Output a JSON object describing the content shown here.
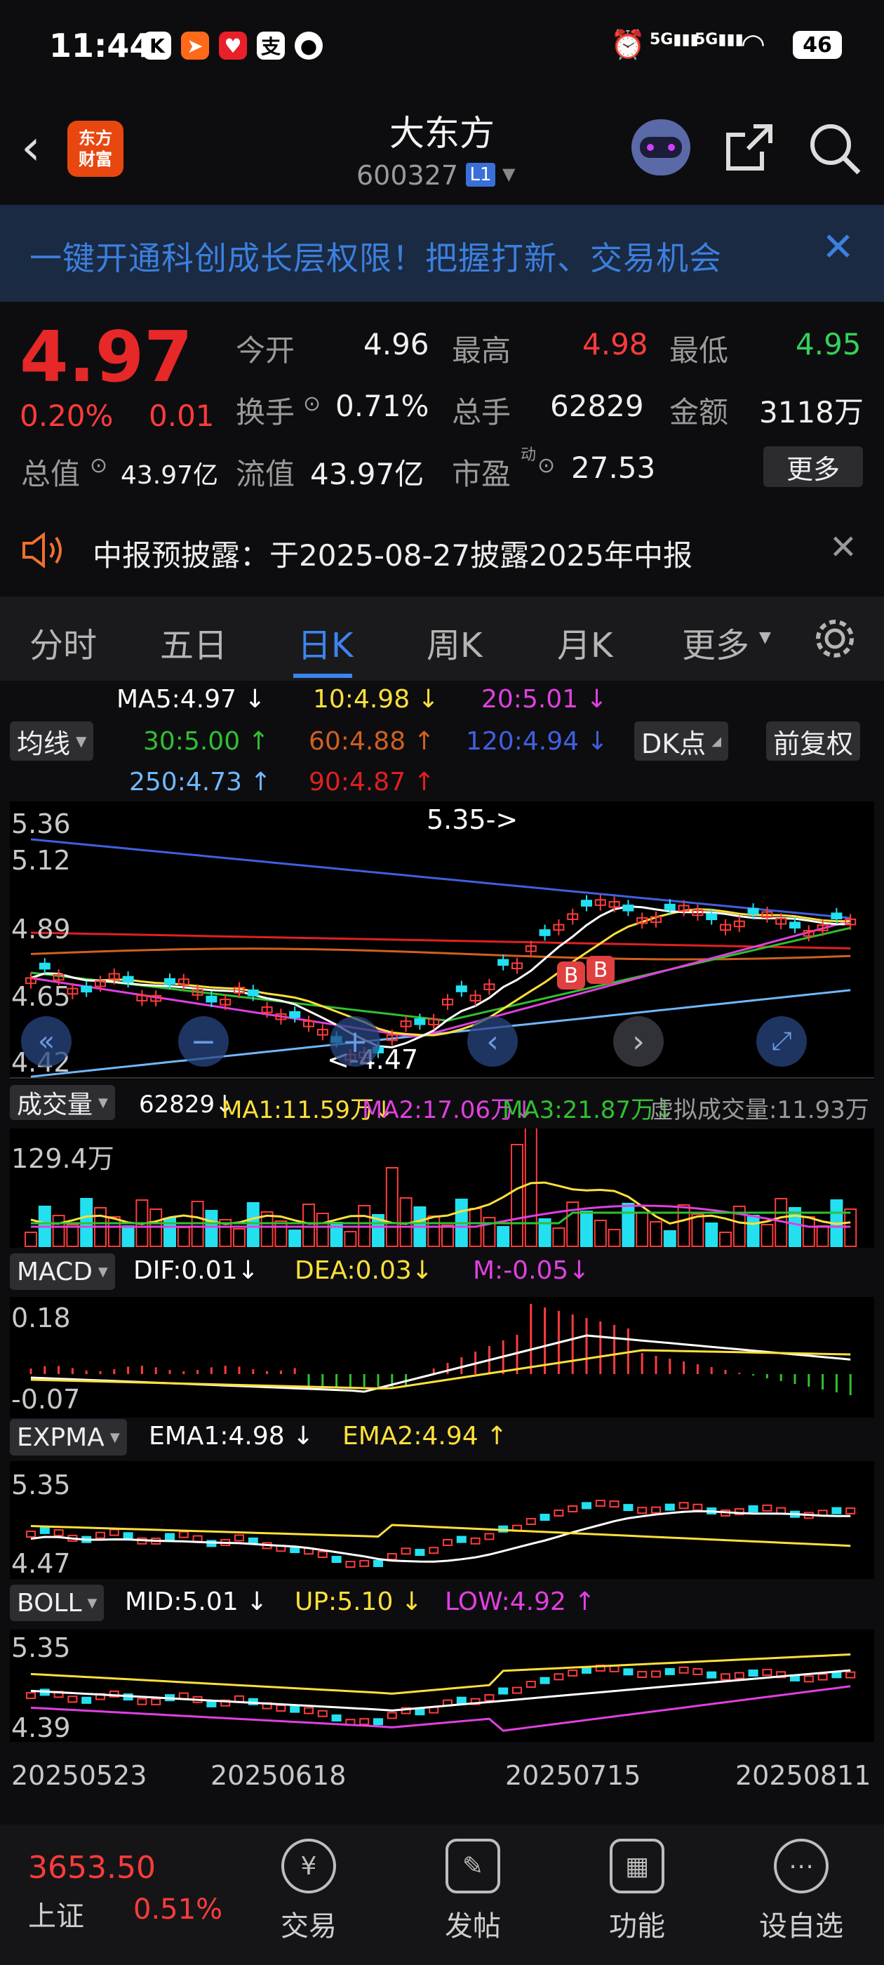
{
  "status": {
    "time": "11:44",
    "battery": "46",
    "icons": [
      "k-app-icon",
      "paper-plane-icon",
      "heart-app-icon",
      "alipay-icon",
      "location-icon"
    ]
  },
  "header": {
    "title": "大东方",
    "code": "600327",
    "badge": "L1",
    "logo_line1": "东方",
    "logo_line2": "财富"
  },
  "banner": {
    "text": "一键开通科创成长层权限！把握打新、交易机会"
  },
  "quote": {
    "price": "4.97",
    "pct": "0.20%",
    "chg": "0.01",
    "open_label": "今开",
    "open": "4.96",
    "high_label": "最高",
    "high": "4.98",
    "low_label": "最低",
    "low": "4.95",
    "turnover_label": "换手",
    "turnover": "0.71%",
    "volume_label": "总手",
    "volume": "62829",
    "amount_label": "金额",
    "amount": "3118万",
    "mcap_label": "总值",
    "mcap": "43.97亿",
    "float_label": "流值",
    "float": "43.97亿",
    "pe_label": "市盈",
    "pe_sup": "动",
    "pe": "27.53",
    "more": "更多"
  },
  "notice": {
    "text": "中报预披露：于2025-08-27披露2025年中报"
  },
  "tabs": {
    "items": [
      "分时",
      "五日",
      "日K",
      "周K",
      "月K",
      "更多"
    ],
    "active": 2
  },
  "ma": {
    "selector": "均线",
    "dk": "DK点",
    "adj": "前复权",
    "ma5": "MA5:4.97",
    "ma10": "10:4.98",
    "ma20": "20:5.01",
    "ma30": "30:5.00",
    "ma60": "60:4.88",
    "ma120": "120:4.94",
    "ma250": "250:4.73",
    "ma90": "90:4.87",
    "ma5_arrow": "↓",
    "ma10_arrow": "↓",
    "ma20_arrow": "↓",
    "ma30_arrow": "↑",
    "ma60_arrow": "↑",
    "ma120_arrow": "↓",
    "ma250_arrow": "↑",
    "ma90_arrow": "↑"
  },
  "kline": {
    "y1": "5.36",
    "y2": "5.12",
    "y3": "4.89",
    "y4": "4.65",
    "y5": "4.42",
    "peak_label": "5.35->",
    "trough_label": "<-4.47",
    "marker": "B"
  },
  "volume": {
    "selector": "成交量",
    "vol": "62829",
    "vol_arrow": "↓",
    "ma1": "MA1:11.59万",
    "ma1_arrow": "↓",
    "ma2": "MA2:17.06万",
    "ma2_arrow": "↓",
    "ma3": "MA3:21.87万",
    "ma3_arrow": "↓",
    "virtual": "虚拟成交量:11.93万",
    "ymax": "129.4万"
  },
  "macd": {
    "selector": "MACD",
    "dif": "DIF:0.01",
    "dif_arrow": "↓",
    "dea": "DEA:0.03",
    "dea_arrow": "↓",
    "m": "M:-0.05",
    "m_arrow": "↓",
    "ymax": "0.18",
    "ymin": "-0.07"
  },
  "expma": {
    "selector": "EXPMA",
    "ema1": "EMA1:4.98",
    "ema1_arrow": "↓",
    "ema2": "EMA2:4.94",
    "ema2_arrow": "↑",
    "ymax": "5.35",
    "ymin": "4.47"
  },
  "boll": {
    "selector": "BOLL",
    "mid": "MID:5.01",
    "mid_arrow": "↓",
    "up": "UP:5.10",
    "up_arrow": "↓",
    "low": "LOW:4.92",
    "low_arrow": "↑",
    "ymax": "5.35",
    "ymin": "4.39"
  },
  "dates": [
    "20250523",
    "20250618",
    "20250715",
    "20250811"
  ],
  "bottom": {
    "index_value": "3653.50",
    "index_name": "上证",
    "index_pct": "0.51%",
    "nav": [
      "交易",
      "发帖",
      "功能",
      "设自选"
    ]
  },
  "colors": {
    "up": "#ff3b3b",
    "down": "#22e0f0",
    "ma5": "#ffffff",
    "ma10": "#ffe03a",
    "ma20": "#e040e0",
    "ma30": "#30c030",
    "ma60": "#d06020",
    "ma120": "#4060e0",
    "ma250": "#70b8ff",
    "ma90": "#e02020",
    "accent": "#3c85f0"
  }
}
